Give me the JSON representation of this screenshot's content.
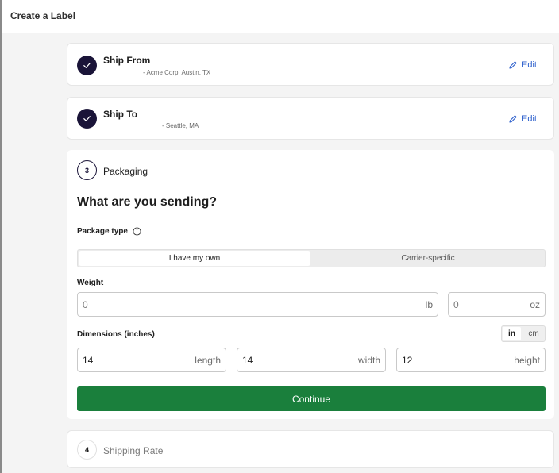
{
  "header": {
    "title": "Create a Label"
  },
  "ship_from": {
    "title": "Ship From",
    "detail": "- Acme Corp, Austin, TX",
    "edit_label": "Edit"
  },
  "ship_to": {
    "title": "Ship To",
    "detail": "- Seattle, MA",
    "edit_label": "Edit"
  },
  "packaging": {
    "step_number": "3",
    "title": "Packaging",
    "question": "What are you sending?",
    "package_type_label": "Package type",
    "package_type_options": [
      "I have my own",
      "Carrier-specific"
    ],
    "package_type_selected": "I have my own",
    "weight_label": "Weight",
    "weight_lb": {
      "value": "0",
      "unit": "lb"
    },
    "weight_oz": {
      "value": "0",
      "unit": "oz"
    },
    "dimensions_label": "Dimensions (inches)",
    "dimension_units": [
      "in",
      "cm"
    ],
    "dimension_unit_selected": "in",
    "length": {
      "value": "14",
      "unit": "length"
    },
    "width": {
      "value": "14",
      "unit": "width"
    },
    "height": {
      "value": "12",
      "unit": "height"
    },
    "continue_label": "Continue"
  },
  "shipping_rate": {
    "step_number": "4",
    "title": "Shipping Rate"
  },
  "colors": {
    "brand_dark": "#1a1438",
    "link_blue": "#2c5fcc",
    "continue_green": "#1a7f3c"
  }
}
